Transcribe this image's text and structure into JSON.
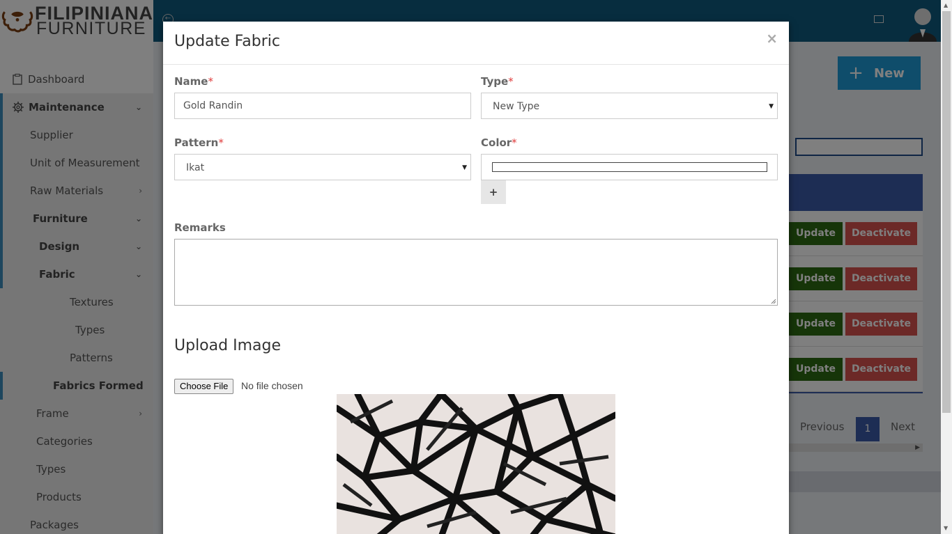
{
  "brand": {
    "line1": "FILIPINIANA",
    "line2": "FURNITURE"
  },
  "sidebar": {
    "items": [
      {
        "label": "Dashboard"
      },
      {
        "label": "Maintenance"
      },
      {
        "label": "Supplier"
      },
      {
        "label": "Unit of Measurement"
      },
      {
        "label": "Raw Materials"
      },
      {
        "label": "Furniture"
      },
      {
        "label": "Design"
      },
      {
        "label": "Fabric"
      },
      {
        "label": "Textures"
      },
      {
        "label": "Types"
      },
      {
        "label": "Patterns"
      },
      {
        "label": "Fabrics Formed"
      },
      {
        "label": "Frame"
      },
      {
        "label": "Categories"
      },
      {
        "label": "Types"
      },
      {
        "label": "Products"
      },
      {
        "label": "Packages"
      }
    ]
  },
  "background": {
    "new_button": "New",
    "row_actions": [
      {
        "update": "Update",
        "deactivate": "Deactivate"
      },
      {
        "update": "Update",
        "deactivate": "Deactivate"
      },
      {
        "update": "Update",
        "deactivate": "Deactivate"
      },
      {
        "update": "Update",
        "deactivate": "Deactivate"
      }
    ],
    "pager": {
      "previous": "Previous",
      "current": "1",
      "next": "Next"
    }
  },
  "modal": {
    "title": "Update Fabric",
    "close": "×",
    "name": {
      "label": "Name",
      "value": "Gold Randin"
    },
    "type": {
      "label": "Type",
      "value": "New Type"
    },
    "pattern": {
      "label": "Pattern",
      "value": "Ikat"
    },
    "color": {
      "label": "Color",
      "add": "+"
    },
    "required_mark": "*",
    "remarks": {
      "label": "Remarks",
      "value": ""
    },
    "upload": {
      "title": "Upload Image",
      "button": "Choose File",
      "status": "No file chosen"
    }
  },
  "colors": {
    "topbar": "#0f5a7e",
    "accent": "#3c8dbc",
    "update_button": "#2d6a12",
    "deactivate_button": "#d9534f",
    "table_header": "#3b5ba8",
    "new_button": "#1e9bd6"
  }
}
